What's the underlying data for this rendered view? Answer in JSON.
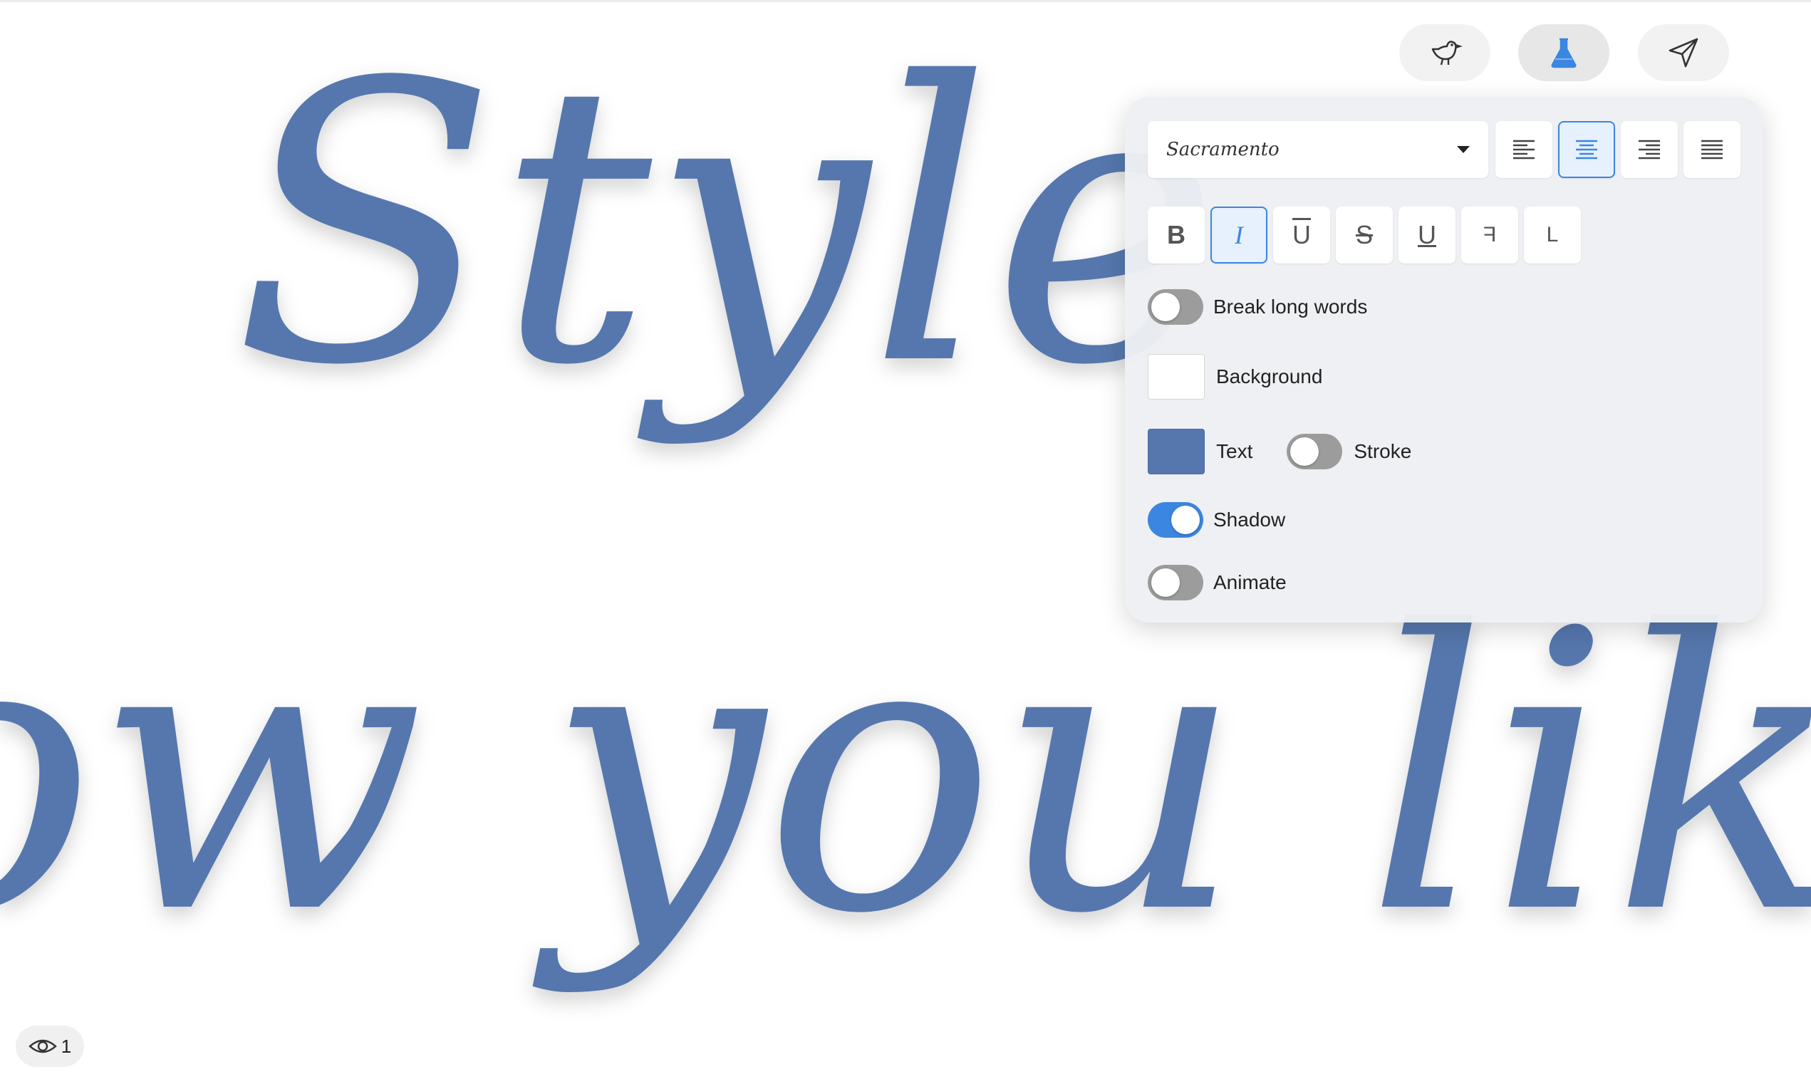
{
  "canvas": {
    "script_lines": [
      "Style",
      "how you like."
    ],
    "text_color": "#5677ad"
  },
  "nav": {
    "buttons": [
      {
        "name": "bird-icon",
        "active": false
      },
      {
        "name": "flask-icon",
        "active": true
      },
      {
        "name": "send-icon",
        "active": false
      }
    ],
    "accent": "#3b86e0"
  },
  "panel": {
    "font": {
      "selected": "Sacramento"
    },
    "alignment": {
      "options": [
        "align-left",
        "align-center",
        "align-right",
        "align-justify"
      ],
      "selected": "align-center"
    },
    "formatting": {
      "bold": "B",
      "italic": "I",
      "overline": "U",
      "strikethrough": "S",
      "underline": "U",
      "flip_horizontal": "F",
      "flip_vertical": "L",
      "active": [
        "italic"
      ]
    },
    "break_long_words": {
      "label": "Break long words",
      "on": false
    },
    "background": {
      "label": "Background",
      "color": "#ffffff"
    },
    "text_color": {
      "label": "Text",
      "color": "#5677ad"
    },
    "stroke": {
      "label": "Stroke",
      "on": false
    },
    "shadow": {
      "label": "Shadow",
      "on": true
    },
    "animate": {
      "label": "Animate",
      "on": false
    }
  },
  "viewers": {
    "count": "1"
  }
}
